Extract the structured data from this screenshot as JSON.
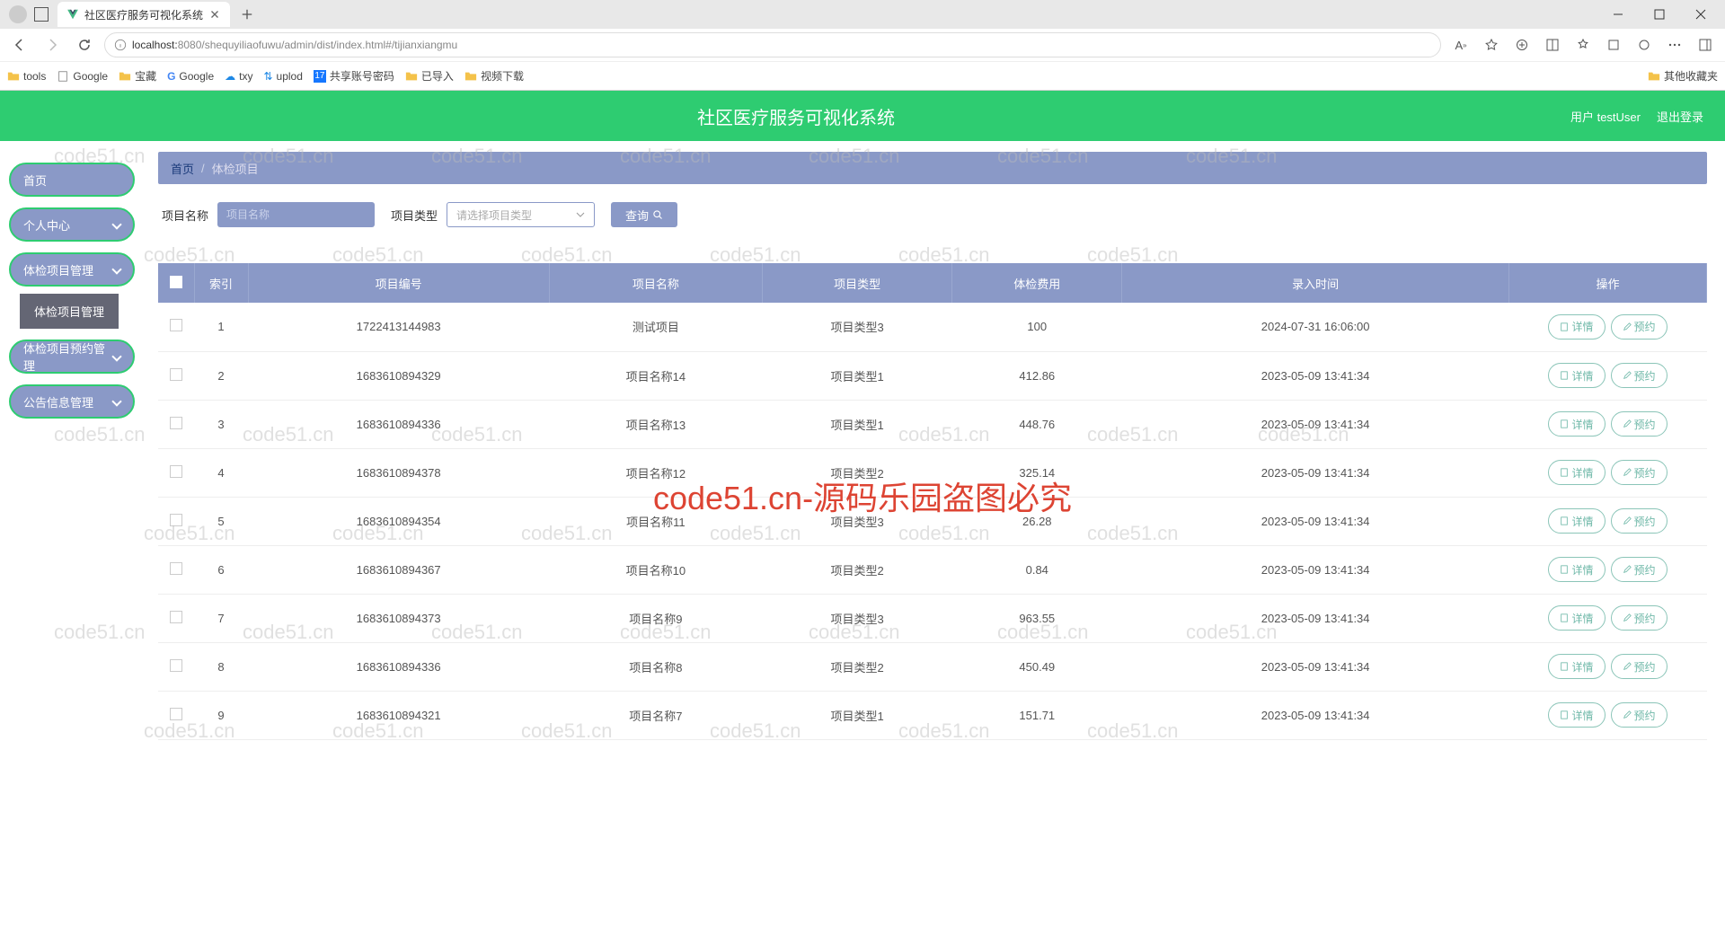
{
  "browser": {
    "tab_title": "社区医疗服务可视化系统",
    "url_prefix": "localhost:",
    "url_rest": "8080/shequyiliaofuwu/admin/dist/index.html#/tijianxiangmu",
    "bookmarks": [
      "tools",
      "Google",
      "宝藏",
      "Google",
      "txy",
      "uplod",
      "共享账号密码",
      "已导入",
      "视频下载"
    ],
    "other_bookmarks": "其他收藏夹"
  },
  "app": {
    "title": "社区医疗服务可视化系统",
    "user_label": "用户 testUser",
    "logout": "退出登录"
  },
  "sidebar": {
    "home": "首页",
    "items": [
      "个人中心",
      "体检项目管理",
      "体检项目预约管理",
      "公告信息管理"
    ],
    "sub": "体检项目管理"
  },
  "breadcrumb": {
    "home": "首页",
    "current": "体检项目"
  },
  "search": {
    "name_label": "项目名称",
    "name_placeholder": "项目名称",
    "type_label": "项目类型",
    "type_placeholder": "请选择项目类型",
    "query": "查询"
  },
  "table": {
    "headers": [
      "",
      "索引",
      "项目编号",
      "项目名称",
      "项目类型",
      "体检费用",
      "录入时间",
      "操作"
    ],
    "action_detail": "详情",
    "action_book": "预约",
    "rows": [
      {
        "idx": "1",
        "code": "1722413144983",
        "name": "测试项目",
        "type": "项目类型3",
        "fee": "100",
        "time": "2024-07-31 16:06:00"
      },
      {
        "idx": "2",
        "code": "1683610894329",
        "name": "项目名称14",
        "type": "项目类型1",
        "fee": "412.86",
        "time": "2023-05-09 13:41:34"
      },
      {
        "idx": "3",
        "code": "1683610894336",
        "name": "项目名称13",
        "type": "项目类型1",
        "fee": "448.76",
        "time": "2023-05-09 13:41:34"
      },
      {
        "idx": "4",
        "code": "1683610894378",
        "name": "项目名称12",
        "type": "项目类型2",
        "fee": "325.14",
        "time": "2023-05-09 13:41:34"
      },
      {
        "idx": "5",
        "code": "1683610894354",
        "name": "项目名称11",
        "type": "项目类型3",
        "fee": "26.28",
        "time": "2023-05-09 13:41:34"
      },
      {
        "idx": "6",
        "code": "1683610894367",
        "name": "项目名称10",
        "type": "项目类型2",
        "fee": "0.84",
        "time": "2023-05-09 13:41:34"
      },
      {
        "idx": "7",
        "code": "1683610894373",
        "name": "项目名称9",
        "type": "项目类型3",
        "fee": "963.55",
        "time": "2023-05-09 13:41:34"
      },
      {
        "idx": "8",
        "code": "1683610894336",
        "name": "项目名称8",
        "type": "项目类型2",
        "fee": "450.49",
        "time": "2023-05-09 13:41:34"
      },
      {
        "idx": "9",
        "code": "1683610894321",
        "name": "项目名称7",
        "type": "项目类型1",
        "fee": "151.71",
        "time": "2023-05-09 13:41:34"
      }
    ]
  },
  "watermark": {
    "small": "code51.cn",
    "big": "code51.cn-源码乐园盗图必究"
  }
}
